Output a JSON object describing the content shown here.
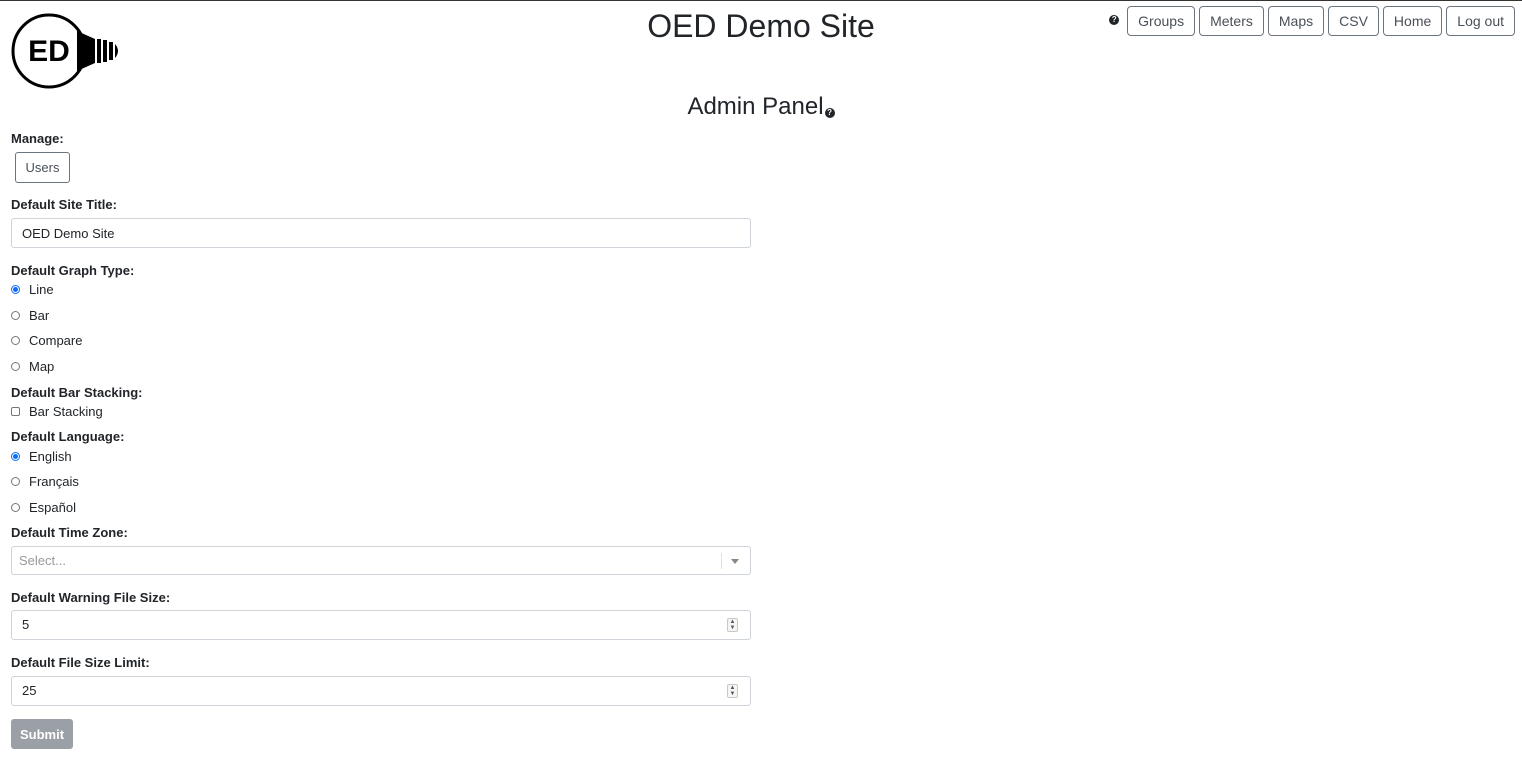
{
  "header": {
    "logo_text": "ED",
    "site_title": "OED Demo Site",
    "help_icon": "question-circle-icon",
    "nav": [
      "Groups",
      "Meters",
      "Maps",
      "CSV",
      "Home",
      "Log out"
    ]
  },
  "panel": {
    "title": "Admin Panel",
    "manage_label": "Manage:",
    "users_button": "Users",
    "site_title_label": "Default Site Title:",
    "site_title_value": "OED Demo Site",
    "graph_type_label": "Default Graph Type:",
    "graph_types": [
      {
        "label": "Line",
        "selected": true
      },
      {
        "label": "Bar",
        "selected": false
      },
      {
        "label": "Compare",
        "selected": false
      },
      {
        "label": "Map",
        "selected": false
      }
    ],
    "bar_stacking_label": "Default Bar Stacking:",
    "bar_stacking_option": "Bar Stacking",
    "bar_stacking_checked": false,
    "language_label": "Default Language:",
    "languages": [
      {
        "label": "English",
        "selected": true
      },
      {
        "label": "Français",
        "selected": false
      },
      {
        "label": "Español",
        "selected": false
      }
    ],
    "timezone_label": "Default Time Zone:",
    "timezone_placeholder": "Select...",
    "warning_size_label": "Default Warning File Size:",
    "warning_size_value": "5",
    "size_limit_label": "Default File Size Limit:",
    "size_limit_value": "25",
    "submit_label": "Submit"
  },
  "colors": {
    "accent": "#0d6efd",
    "submit_disabled": "#9aa0a6",
    "text": "#212529"
  }
}
